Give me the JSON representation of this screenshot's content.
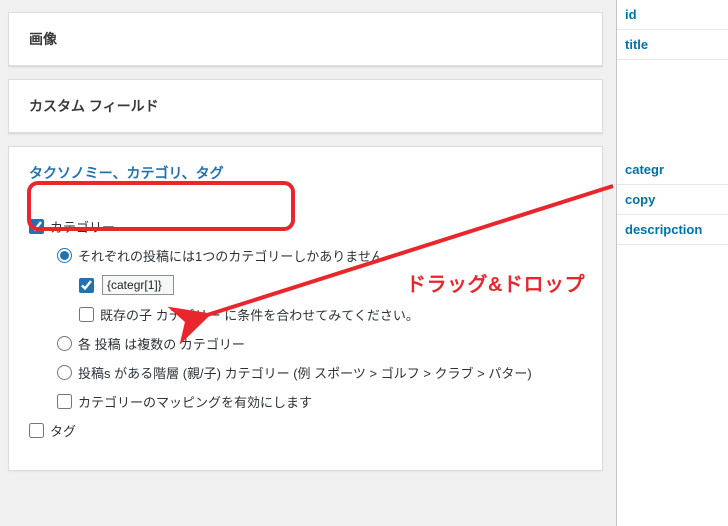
{
  "colors": {
    "accent": "#2271b1",
    "link": "#0073aa",
    "annotation": "#e9262b"
  },
  "annotation": {
    "label": "ドラッグ&ドロップ"
  },
  "boxes": {
    "image": {
      "title": "画像"
    },
    "custom_fields": {
      "title": "カスタム フィールド"
    },
    "taxonomy": {
      "title": "タクソノミー、カテゴリ、タグ",
      "category_label": "カテゴリー",
      "radio_single": "それぞれの投稿には1つのカテゴリーしかありません",
      "token_value": "{categr[1]}",
      "child_hint": "既存の子 カテゴリー に条件を合わせてみてください。",
      "radio_multi": "各 投稿 は複数の カテゴリー",
      "radio_hier": "投稿s がある階層 (親/子) カテゴリー (例 スポーツ > ゴルフ > クラブ > パター)",
      "mapping_label": "カテゴリーのマッピングを有効にします",
      "tag_label": "タグ"
    }
  },
  "side": {
    "items": [
      "id",
      "title",
      "categr",
      "copy",
      "descripction"
    ]
  }
}
